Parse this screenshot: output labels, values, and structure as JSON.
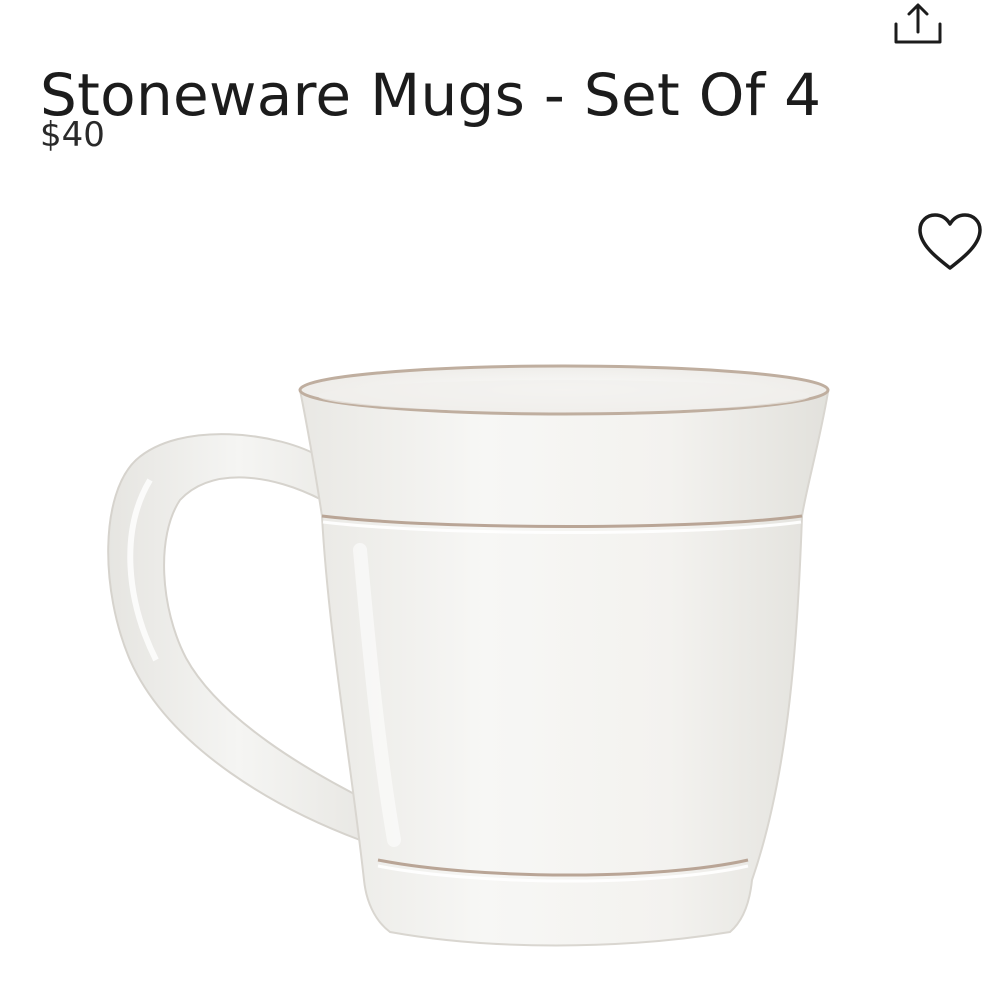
{
  "product": {
    "title": "Stoneware Mugs - Set Of 4",
    "price": "$40"
  },
  "icons": {
    "share": "share-icon",
    "favorite": "heart-outline-icon"
  },
  "image": {
    "subject": "white-stoneware-mug"
  },
  "colors": {
    "text": "#1c1c1c",
    "background": "#ffffff",
    "mug_body": "#f4f3f0",
    "mug_rim": "#b9a596"
  }
}
